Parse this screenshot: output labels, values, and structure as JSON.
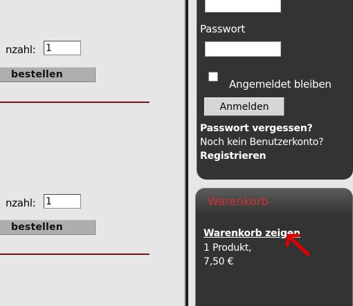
{
  "products": [
    {
      "qty_label": "nzahl:",
      "qty_value": "1",
      "order_label": "bestellen"
    },
    {
      "qty_label": "nzahl:",
      "qty_value": "1",
      "order_label": "bestellen"
    }
  ],
  "login": {
    "username_value": "",
    "password_label": "Passwort",
    "password_value": "",
    "remember_label": "Angemeldet bleiben",
    "login_button": "Anmelden",
    "forgot_password": "Passwort vergessen?",
    "no_account": "Noch kein Benutzerkonto?",
    "register": "Registrieren"
  },
  "cart": {
    "title": "Warenkorb",
    "show_cart": "Warenkorb zeigen",
    "product_count": "1 Produkt,",
    "total": "7,50 €"
  },
  "colors": {
    "divider": "#7a1010",
    "sidebar_bg": "#333333",
    "cart_title": "#d43030",
    "arrow": "#e00000"
  },
  "icons": [
    "red-arrow-icon"
  ]
}
